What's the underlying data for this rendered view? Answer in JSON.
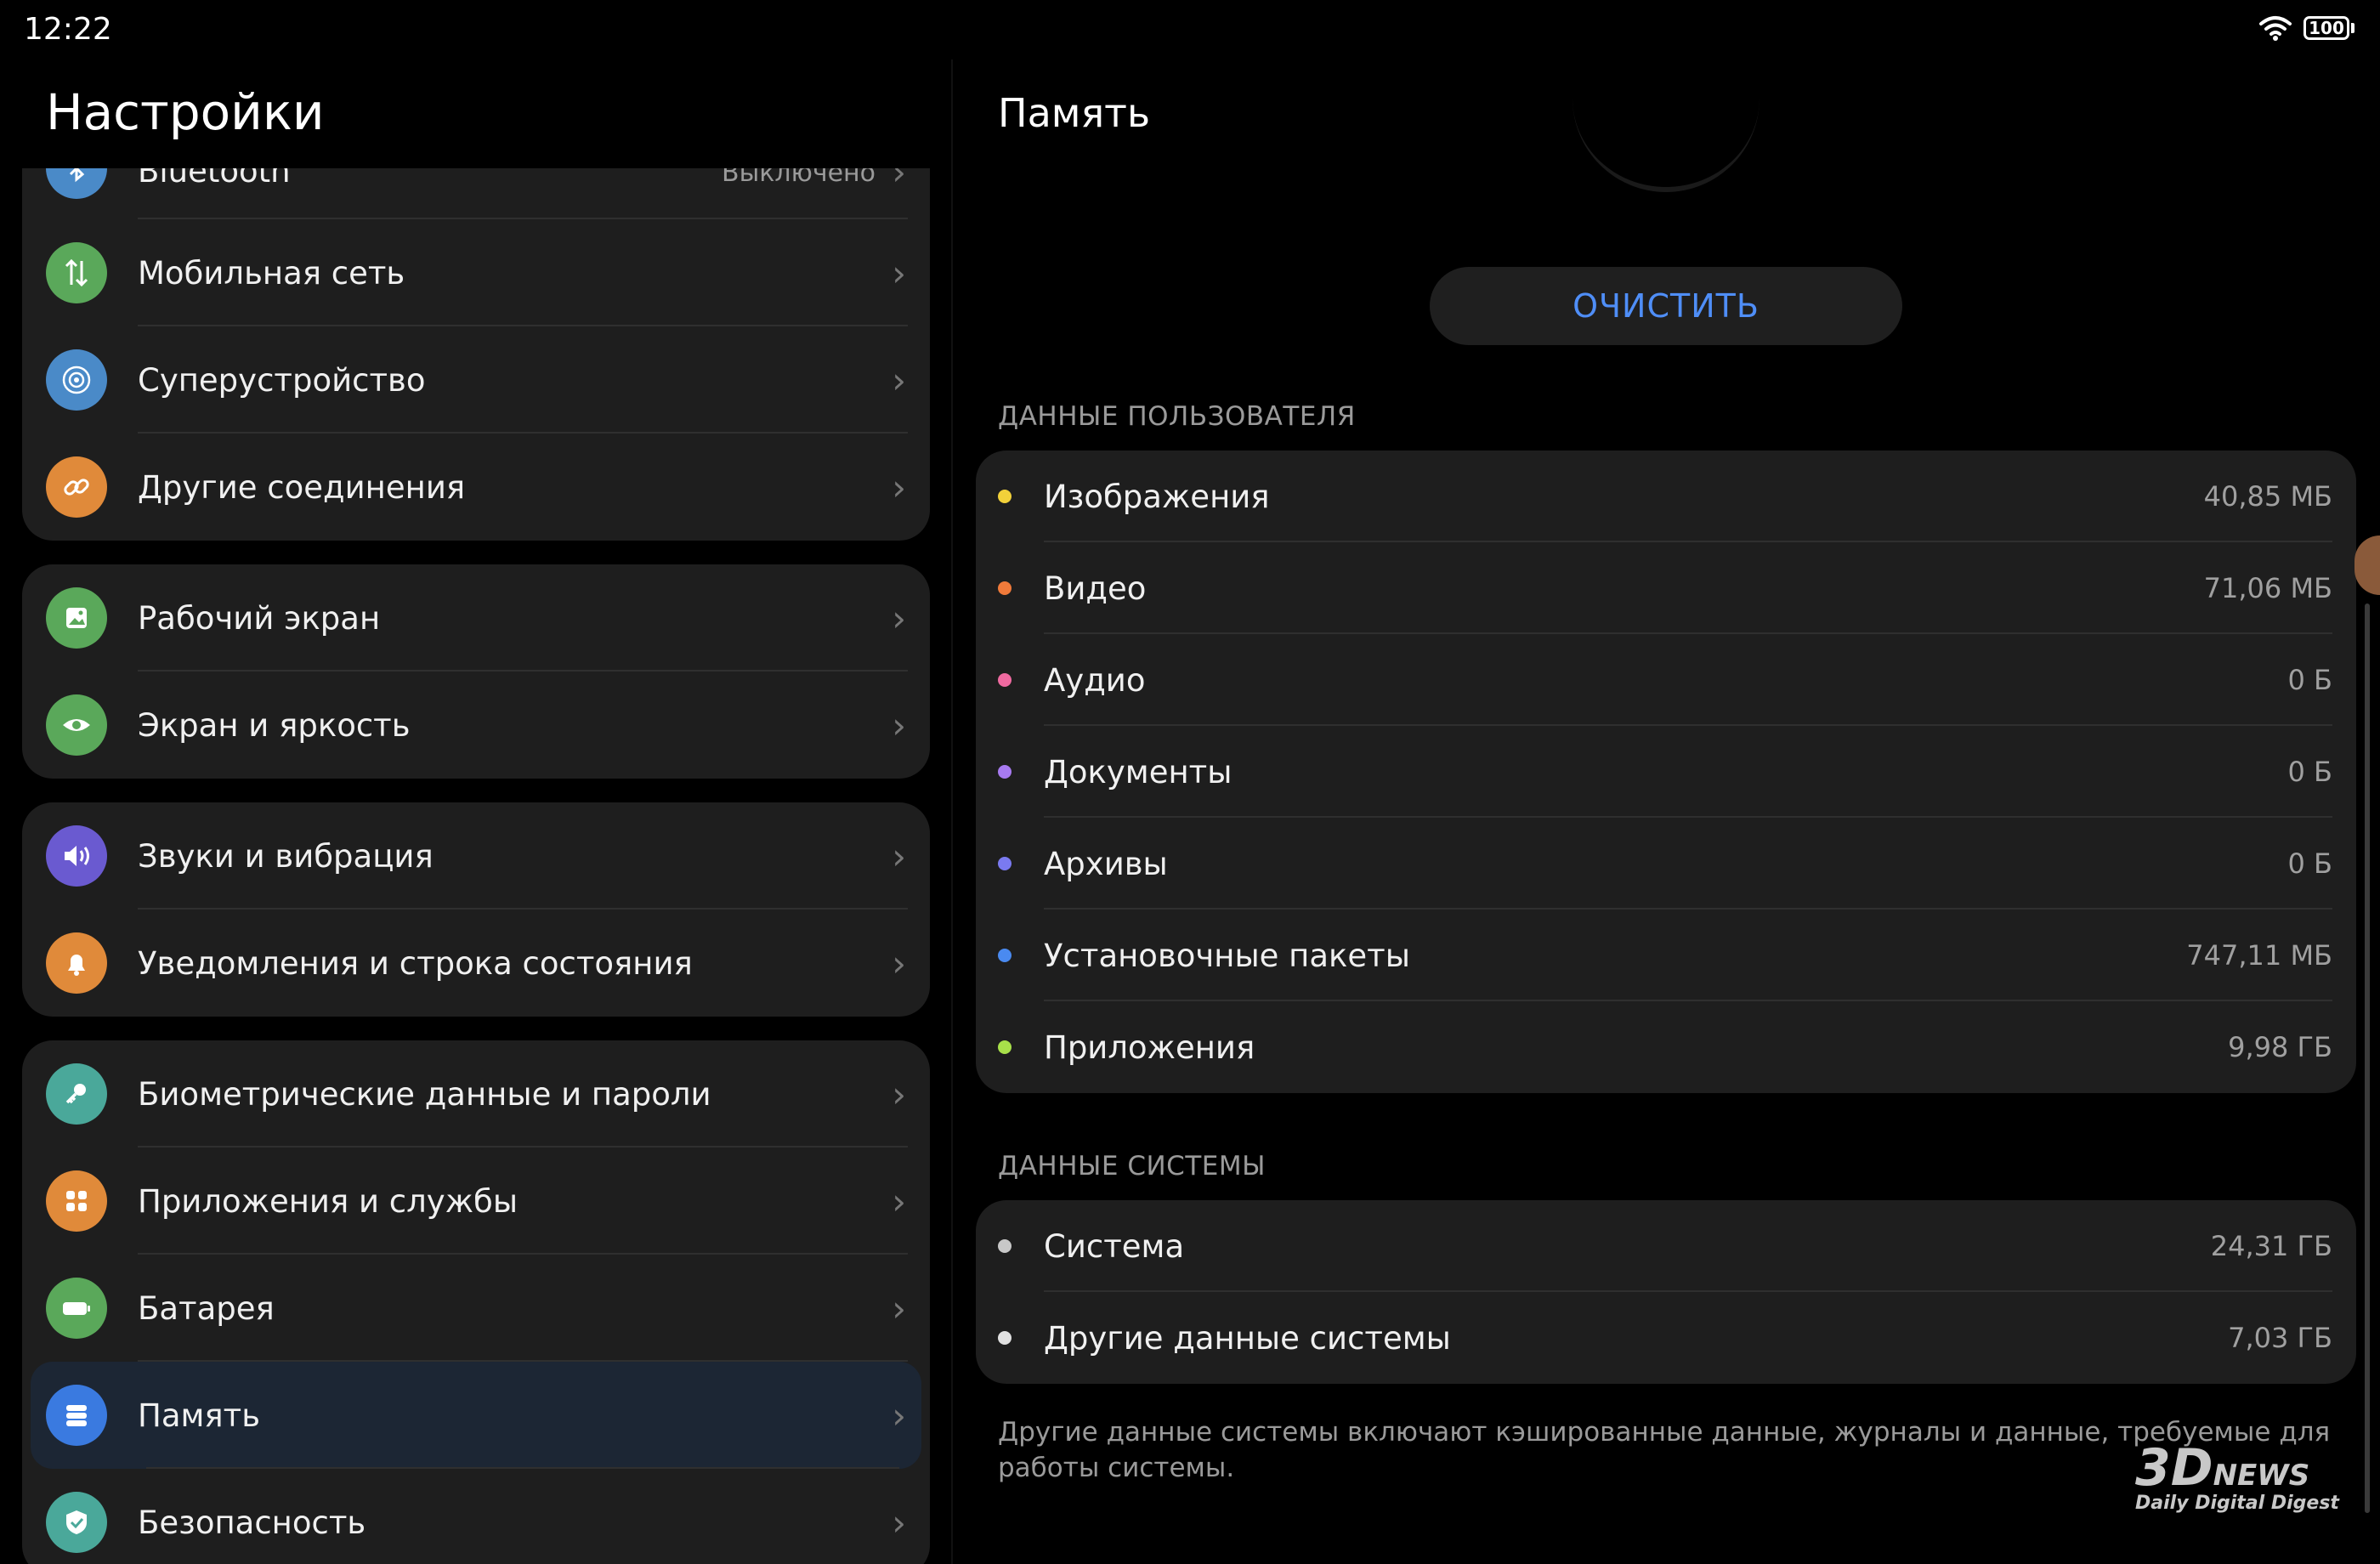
{
  "status": {
    "time": "12:22",
    "battery": "100"
  },
  "left": {
    "title": "Настройки",
    "partial_item": {
      "label": "Bluetooth",
      "value": "Выключено"
    },
    "groups": [
      [
        {
          "label": "Мобильная сеть",
          "icon": "mobile-network-icon",
          "color": "#5aa85a"
        },
        {
          "label": "Суперустройство",
          "icon": "superdevice-icon",
          "color": "#4a8ac8"
        },
        {
          "label": "Другие соединения",
          "icon": "link-icon",
          "color": "#e08a3a"
        }
      ],
      [
        {
          "label": "Рабочий экран",
          "icon": "home-screen-icon",
          "color": "#5aa85a"
        },
        {
          "label": "Экран и яркость",
          "icon": "eye-icon",
          "color": "#5aa85a"
        }
      ],
      [
        {
          "label": "Звуки и вибрация",
          "icon": "sound-icon",
          "color": "#6a5ad0"
        },
        {
          "label": "Уведомления и строка состояния",
          "icon": "bell-icon",
          "color": "#e08a3a"
        }
      ],
      [
        {
          "label": "Биометрические данные и пароли",
          "icon": "key-icon",
          "color": "#4aa89a"
        },
        {
          "label": "Приложения и службы",
          "icon": "apps-icon",
          "color": "#e08a3a"
        },
        {
          "label": "Батарея",
          "icon": "battery-icon",
          "color": "#5aa85a"
        },
        {
          "label": "Память",
          "icon": "storage-icon",
          "color": "#3a7ae0",
          "selected": true
        },
        {
          "label": "Безопасность",
          "icon": "shield-icon",
          "color": "#4aa89a"
        }
      ]
    ]
  },
  "right": {
    "title": "Память",
    "clean_button": "ОЧИСТИТЬ",
    "user_data_header": "ДАННЫЕ ПОЛЬЗОВАТЕЛЯ",
    "user_data": [
      {
        "name": "Изображения",
        "size": "40,85 МБ",
        "color": "#f2d13a"
      },
      {
        "name": "Видео",
        "size": "71,06 МБ",
        "color": "#f07a3a"
      },
      {
        "name": "Аудио",
        "size": "0 Б",
        "color": "#f06aa0"
      },
      {
        "name": "Документы",
        "size": "0 Б",
        "color": "#a77af0"
      },
      {
        "name": "Архивы",
        "size": "0 Б",
        "color": "#7a7af0"
      },
      {
        "name": "Установочные пакеты",
        "size": "747,11 МБ",
        "color": "#4a8af0"
      },
      {
        "name": "Приложения",
        "size": "9,98 ГБ",
        "color": "#a8e04a"
      }
    ],
    "system_data_header": "ДАННЫЕ СИСТЕМЫ",
    "system_data": [
      {
        "name": "Система",
        "size": "24,31 ГБ",
        "color": "#c8c8c8"
      },
      {
        "name": "Другие данные системы",
        "size": "7,03 ГБ",
        "color": "#e0e0e0"
      }
    ],
    "footnote": "Другие данные системы включают кэшированные данные, журналы и данные, требуемые для работы системы."
  },
  "watermark": {
    "main": "3D",
    "news": "NEWS",
    "sub": "Daily Digital Digest"
  }
}
